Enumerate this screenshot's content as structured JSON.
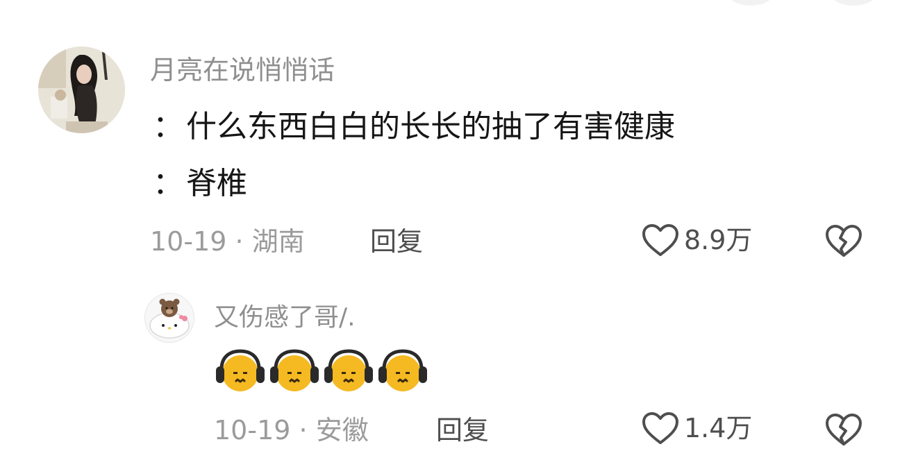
{
  "comment": {
    "username": "月亮在说悄悄话",
    "lines": [
      {
        "prefix": "：",
        "text": "什么东西白白的长长的抽了有害健康"
      },
      {
        "prefix": "：",
        "text": "脊椎"
      }
    ],
    "date": "10-19",
    "separator": "·",
    "location": "湖南",
    "reply_label": "回复",
    "like_count": "8.9万",
    "icons": {
      "like": "heart-outline-icon",
      "dislike": "broken-heart-icon",
      "avatar": "user-photo-avatar"
    }
  },
  "reply": {
    "username": "又伤感了哥/.",
    "emojis": [
      "headphones-sad-face",
      "headphones-sad-face",
      "headphones-sad-face",
      "headphones-sad-face"
    ],
    "date": "10-19",
    "separator": "·",
    "location": "安徽",
    "reply_label": "回复",
    "like_count": "1.4万",
    "icons": {
      "like": "heart-outline-icon",
      "dislike": "broken-heart-icon",
      "avatar": "bear-cat-avatar"
    }
  },
  "colors": {
    "username": "#8f8f8f",
    "text": "#161616",
    "meta": "#9b9b9b",
    "action": "#4e4e4e",
    "emoji_face": "#f5b922"
  }
}
